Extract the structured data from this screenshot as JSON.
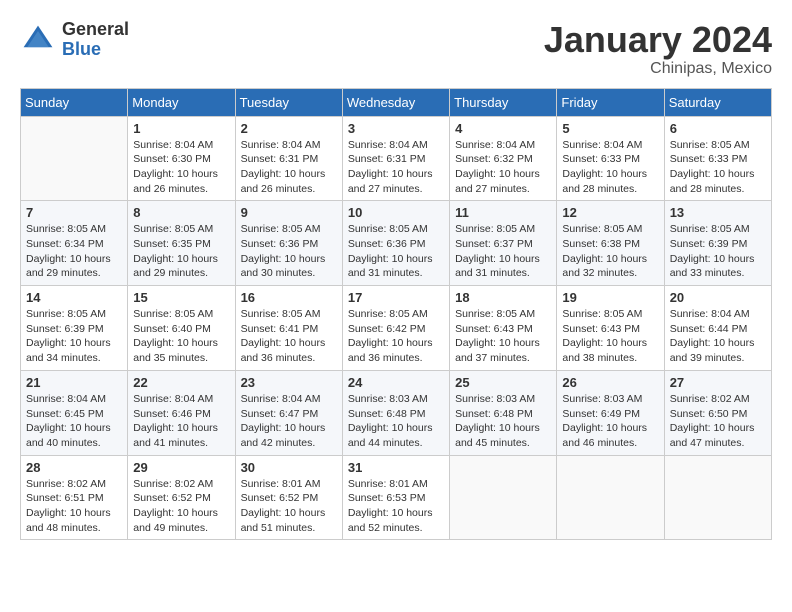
{
  "header": {
    "logo_general": "General",
    "logo_blue": "Blue",
    "month_title": "January 2024",
    "location": "Chinipas, Mexico"
  },
  "days_of_week": [
    "Sunday",
    "Monday",
    "Tuesday",
    "Wednesday",
    "Thursday",
    "Friday",
    "Saturday"
  ],
  "weeks": [
    [
      {
        "day": "",
        "sunrise": "",
        "sunset": "",
        "daylight": ""
      },
      {
        "day": "1",
        "sunrise": "Sunrise: 8:04 AM",
        "sunset": "Sunset: 6:30 PM",
        "daylight": "Daylight: 10 hours and 26 minutes."
      },
      {
        "day": "2",
        "sunrise": "Sunrise: 8:04 AM",
        "sunset": "Sunset: 6:31 PM",
        "daylight": "Daylight: 10 hours and 26 minutes."
      },
      {
        "day": "3",
        "sunrise": "Sunrise: 8:04 AM",
        "sunset": "Sunset: 6:31 PM",
        "daylight": "Daylight: 10 hours and 27 minutes."
      },
      {
        "day": "4",
        "sunrise": "Sunrise: 8:04 AM",
        "sunset": "Sunset: 6:32 PM",
        "daylight": "Daylight: 10 hours and 27 minutes."
      },
      {
        "day": "5",
        "sunrise": "Sunrise: 8:04 AM",
        "sunset": "Sunset: 6:33 PM",
        "daylight": "Daylight: 10 hours and 28 minutes."
      },
      {
        "day": "6",
        "sunrise": "Sunrise: 8:05 AM",
        "sunset": "Sunset: 6:33 PM",
        "daylight": "Daylight: 10 hours and 28 minutes."
      }
    ],
    [
      {
        "day": "7",
        "sunrise": "Sunrise: 8:05 AM",
        "sunset": "Sunset: 6:34 PM",
        "daylight": "Daylight: 10 hours and 29 minutes."
      },
      {
        "day": "8",
        "sunrise": "Sunrise: 8:05 AM",
        "sunset": "Sunset: 6:35 PM",
        "daylight": "Daylight: 10 hours and 29 minutes."
      },
      {
        "day": "9",
        "sunrise": "Sunrise: 8:05 AM",
        "sunset": "Sunset: 6:36 PM",
        "daylight": "Daylight: 10 hours and 30 minutes."
      },
      {
        "day": "10",
        "sunrise": "Sunrise: 8:05 AM",
        "sunset": "Sunset: 6:36 PM",
        "daylight": "Daylight: 10 hours and 31 minutes."
      },
      {
        "day": "11",
        "sunrise": "Sunrise: 8:05 AM",
        "sunset": "Sunset: 6:37 PM",
        "daylight": "Daylight: 10 hours and 31 minutes."
      },
      {
        "day": "12",
        "sunrise": "Sunrise: 8:05 AM",
        "sunset": "Sunset: 6:38 PM",
        "daylight": "Daylight: 10 hours and 32 minutes."
      },
      {
        "day": "13",
        "sunrise": "Sunrise: 8:05 AM",
        "sunset": "Sunset: 6:39 PM",
        "daylight": "Daylight: 10 hours and 33 minutes."
      }
    ],
    [
      {
        "day": "14",
        "sunrise": "Sunrise: 8:05 AM",
        "sunset": "Sunset: 6:39 PM",
        "daylight": "Daylight: 10 hours and 34 minutes."
      },
      {
        "day": "15",
        "sunrise": "Sunrise: 8:05 AM",
        "sunset": "Sunset: 6:40 PM",
        "daylight": "Daylight: 10 hours and 35 minutes."
      },
      {
        "day": "16",
        "sunrise": "Sunrise: 8:05 AM",
        "sunset": "Sunset: 6:41 PM",
        "daylight": "Daylight: 10 hours and 36 minutes."
      },
      {
        "day": "17",
        "sunrise": "Sunrise: 8:05 AM",
        "sunset": "Sunset: 6:42 PM",
        "daylight": "Daylight: 10 hours and 36 minutes."
      },
      {
        "day": "18",
        "sunrise": "Sunrise: 8:05 AM",
        "sunset": "Sunset: 6:43 PM",
        "daylight": "Daylight: 10 hours and 37 minutes."
      },
      {
        "day": "19",
        "sunrise": "Sunrise: 8:05 AM",
        "sunset": "Sunset: 6:43 PM",
        "daylight": "Daylight: 10 hours and 38 minutes."
      },
      {
        "day": "20",
        "sunrise": "Sunrise: 8:04 AM",
        "sunset": "Sunset: 6:44 PM",
        "daylight": "Daylight: 10 hours and 39 minutes."
      }
    ],
    [
      {
        "day": "21",
        "sunrise": "Sunrise: 8:04 AM",
        "sunset": "Sunset: 6:45 PM",
        "daylight": "Daylight: 10 hours and 40 minutes."
      },
      {
        "day": "22",
        "sunrise": "Sunrise: 8:04 AM",
        "sunset": "Sunset: 6:46 PM",
        "daylight": "Daylight: 10 hours and 41 minutes."
      },
      {
        "day": "23",
        "sunrise": "Sunrise: 8:04 AM",
        "sunset": "Sunset: 6:47 PM",
        "daylight": "Daylight: 10 hours and 42 minutes."
      },
      {
        "day": "24",
        "sunrise": "Sunrise: 8:03 AM",
        "sunset": "Sunset: 6:48 PM",
        "daylight": "Daylight: 10 hours and 44 minutes."
      },
      {
        "day": "25",
        "sunrise": "Sunrise: 8:03 AM",
        "sunset": "Sunset: 6:48 PM",
        "daylight": "Daylight: 10 hours and 45 minutes."
      },
      {
        "day": "26",
        "sunrise": "Sunrise: 8:03 AM",
        "sunset": "Sunset: 6:49 PM",
        "daylight": "Daylight: 10 hours and 46 minutes."
      },
      {
        "day": "27",
        "sunrise": "Sunrise: 8:02 AM",
        "sunset": "Sunset: 6:50 PM",
        "daylight": "Daylight: 10 hours and 47 minutes."
      }
    ],
    [
      {
        "day": "28",
        "sunrise": "Sunrise: 8:02 AM",
        "sunset": "Sunset: 6:51 PM",
        "daylight": "Daylight: 10 hours and 48 minutes."
      },
      {
        "day": "29",
        "sunrise": "Sunrise: 8:02 AM",
        "sunset": "Sunset: 6:52 PM",
        "daylight": "Daylight: 10 hours and 49 minutes."
      },
      {
        "day": "30",
        "sunrise": "Sunrise: 8:01 AM",
        "sunset": "Sunset: 6:52 PM",
        "daylight": "Daylight: 10 hours and 51 minutes."
      },
      {
        "day": "31",
        "sunrise": "Sunrise: 8:01 AM",
        "sunset": "Sunset: 6:53 PM",
        "daylight": "Daylight: 10 hours and 52 minutes."
      },
      {
        "day": "",
        "sunrise": "",
        "sunset": "",
        "daylight": ""
      },
      {
        "day": "",
        "sunrise": "",
        "sunset": "",
        "daylight": ""
      },
      {
        "day": "",
        "sunrise": "",
        "sunset": "",
        "daylight": ""
      }
    ]
  ]
}
